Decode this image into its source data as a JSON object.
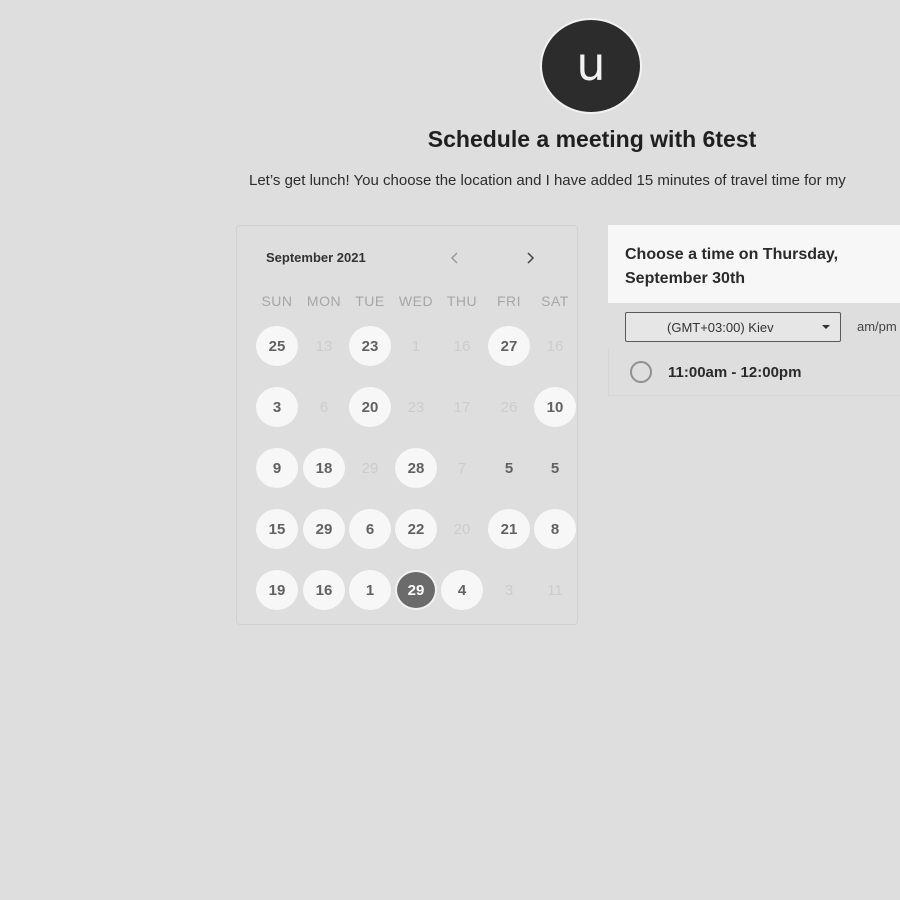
{
  "host": {
    "avatar_letter": "u"
  },
  "header": {
    "title": "Schedule a meeting with 6test",
    "description": "Let’s get lunch! You choose the location and I have added 15 minutes of travel time for my"
  },
  "calendar": {
    "month_label": "September 2021",
    "nav": {
      "prev_icon": "chevron-left-icon",
      "next_icon": "chevron-right-icon"
    },
    "weekdays": [
      "SUN",
      "MON",
      "TUE",
      "WED",
      "THU",
      "FRI",
      "SAT"
    ],
    "weeks": [
      [
        {
          "label": "25",
          "state": "available"
        },
        {
          "label": "13",
          "state": "unavailable"
        },
        {
          "label": "23",
          "state": "available"
        },
        {
          "label": "1",
          "state": "unavailable"
        },
        {
          "label": "16",
          "state": "unavailable"
        },
        {
          "label": "27",
          "state": "available"
        },
        {
          "label": "16",
          "state": "unavailable"
        }
      ],
      [
        {
          "label": "3",
          "state": "available"
        },
        {
          "label": "6",
          "state": "unavailable"
        },
        {
          "label": "20",
          "state": "available"
        },
        {
          "label": "23",
          "state": "unavailable"
        },
        {
          "label": "17",
          "state": "unavailable"
        },
        {
          "label": "26",
          "state": "unavailable"
        },
        {
          "label": "10",
          "state": "available"
        }
      ],
      [
        {
          "label": "9",
          "state": "available"
        },
        {
          "label": "18",
          "state": "available"
        },
        {
          "label": "29",
          "state": "unavailable"
        },
        {
          "label": "28",
          "state": "available"
        },
        {
          "label": "7",
          "state": "unavailable"
        },
        {
          "label": "5",
          "state": "plain"
        },
        {
          "label": "5",
          "state": "plain"
        }
      ],
      [
        {
          "label": "15",
          "state": "available"
        },
        {
          "label": "29",
          "state": "available"
        },
        {
          "label": "6",
          "state": "available"
        },
        {
          "label": "22",
          "state": "available"
        },
        {
          "label": "20",
          "state": "unavailable"
        },
        {
          "label": "21",
          "state": "available"
        },
        {
          "label": "8",
          "state": "available"
        }
      ],
      [
        {
          "label": "19",
          "state": "available"
        },
        {
          "label": "16",
          "state": "available"
        },
        {
          "label": "1",
          "state": "available"
        },
        {
          "label": "29",
          "state": "selected"
        },
        {
          "label": "4",
          "state": "available"
        },
        {
          "label": "3",
          "state": "unavailable"
        },
        {
          "label": "11",
          "state": "unavailable"
        }
      ]
    ]
  },
  "time_panel": {
    "title": "Choose a time on Thursday, September 30th",
    "timezone": {
      "selected": "(GMT+03:00) Kiev",
      "caret_icon": "caret-down-icon"
    },
    "format_toggle": "am/pm",
    "slots": [
      {
        "label": "11:00am - 12:00pm"
      }
    ]
  }
}
